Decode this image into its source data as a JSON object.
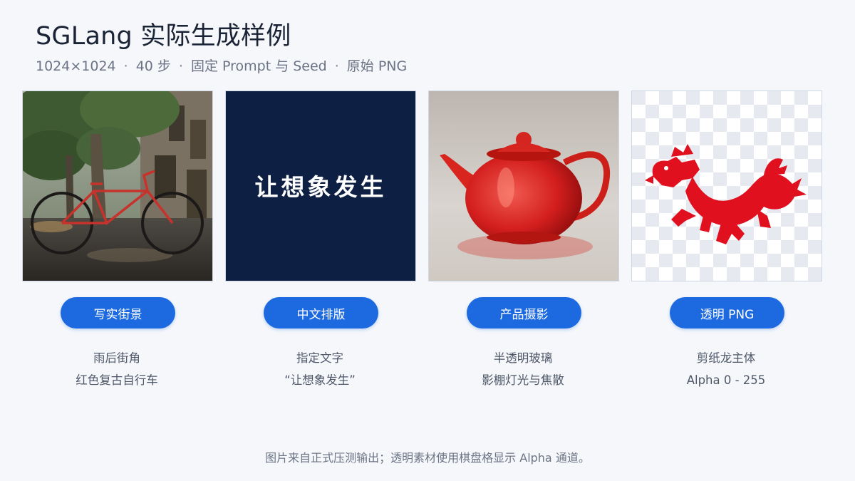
{
  "header": {
    "title": "SGLang 实际生成样例",
    "meta": [
      "1024×1024",
      "40 步",
      "固定 Prompt 与 Seed",
      "原始 PNG"
    ],
    "separator": "·"
  },
  "cards": [
    {
      "image_subject": "street-bicycle-photo",
      "tag": "写实街景",
      "line1": "雨后街角",
      "line2": "红色复古自行车"
    },
    {
      "image_subject": "chinese-text-poster",
      "poster_text": "让想象发生",
      "tag": "中文排版",
      "line1": "指定文字",
      "line2": "“让想象发生”"
    },
    {
      "image_subject": "red-glass-teapot-photo",
      "tag": "产品摄影",
      "line1": "半透明玻璃",
      "line2": "影棚灯光与焦散"
    },
    {
      "image_subject": "red-paper-cut-dragon",
      "tag": "透明 PNG",
      "line1": "剪纸龙主体",
      "line2": "Alpha 0 - 255"
    }
  ],
  "footer": "图片来自正式压测输出；透明素材使用棋盘格显示 Alpha 通道。",
  "colors": {
    "background": "#f5f7fb",
    "pill": "#1d6ae0",
    "poster_bg": "#0d1f42",
    "dragon": "#e0101e"
  }
}
